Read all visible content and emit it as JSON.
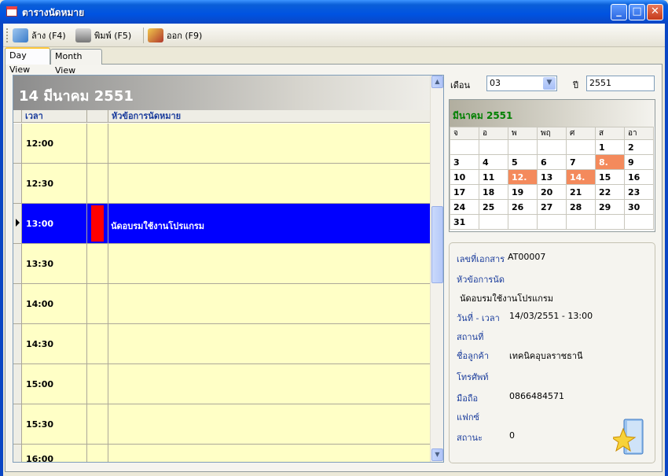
{
  "window": {
    "title": "ตารางนัดหมาย",
    "min": "_",
    "max": "□",
    "close": "✕"
  },
  "toolbar": {
    "clear": "ล้าง (F4)",
    "print": "พิมพ์ (F5)",
    "exit": "ออก (F9)"
  },
  "tabs": [
    "Day View",
    "Month View"
  ],
  "day": {
    "header": "14 มีนาคม 2551",
    "col_time": "เวลา",
    "col_subject": "หัวข้อการนัดหมาย",
    "rows": [
      {
        "time": "12:00",
        "subject": ""
      },
      {
        "time": "12:30",
        "subject": ""
      },
      {
        "time": "13:00",
        "subject": "นัดอบรมใช้งานโปรแกรม",
        "selected": true
      },
      {
        "time": "13:30",
        "subject": ""
      },
      {
        "time": "14:00",
        "subject": ""
      },
      {
        "time": "14:30",
        "subject": ""
      },
      {
        "time": "15:00",
        "subject": ""
      },
      {
        "time": "15:30",
        "subject": ""
      },
      {
        "time": "16:00",
        "subject": ""
      }
    ]
  },
  "filter": {
    "month_label": "เดือน",
    "month_value": "03",
    "year_label": "ปี",
    "year_value": "2551"
  },
  "calendar": {
    "title": "มีนาคม 2551",
    "weekdays": [
      "จ",
      "อ",
      "พ",
      "พฤ",
      "ศ",
      "ส",
      "อา"
    ],
    "weeks": [
      [
        "",
        "",
        "",
        "",
        "",
        "1",
        "2"
      ],
      [
        "3",
        "4",
        "5",
        "6",
        "7",
        "8.",
        "9"
      ],
      [
        "10",
        "11",
        "12.",
        "13",
        "14.",
        "15",
        "16"
      ],
      [
        "17",
        "18",
        "19",
        "20",
        "21",
        "22",
        "23"
      ],
      [
        "24",
        "25",
        "26",
        "27",
        "28",
        "29",
        "30"
      ],
      [
        "31",
        "",
        "",
        "",
        "",
        "",
        ""
      ]
    ],
    "highlighted": [
      "8.",
      "12.",
      "14."
    ],
    "highlight_color": "#f48a5c"
  },
  "details": {
    "doc_no_label": "เลขที่เอกสาร",
    "doc_no": "AT00007",
    "subject_label": "หัวข้อการนัด",
    "subject": "นัดอบรมใช้งานโปรแกรม",
    "datetime_label": "วันที่ - เวลา",
    "datetime": "14/03/2551 - 13:00",
    "place_label": "สถานที่",
    "customer_label": "ชื่อลูกค้า",
    "customer": "เทคนิคอุบลราชธานี",
    "phone_label": "โทรศัพท์",
    "mobile_label": "มือถือ",
    "mobile": "0866484571",
    "fax_label": "แฟกซ์",
    "status_label": "สถานะ",
    "status": "0"
  },
  "colors": {
    "selection": "#0000ff",
    "marker": "#ff0000",
    "row_bg": "#ffffc6",
    "calendar_title": "#008000"
  }
}
